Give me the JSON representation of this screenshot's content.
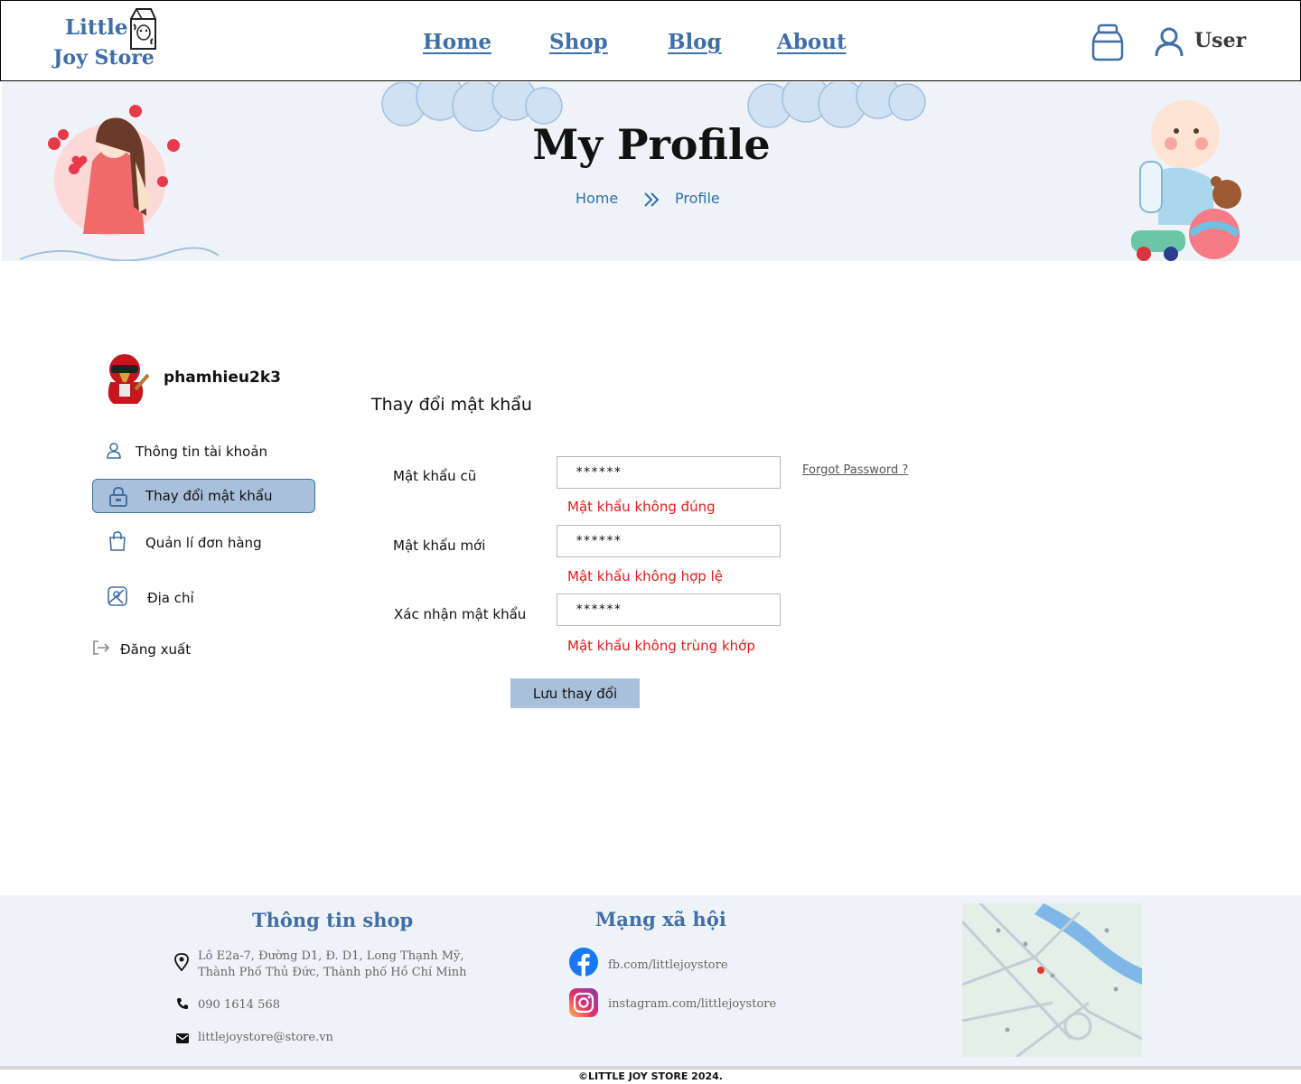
{
  "brand": {
    "line1": "Little",
    "line2": "Joy Store"
  },
  "nav": {
    "items": [
      "Home",
      "Shop",
      "Blog",
      "About"
    ]
  },
  "header": {
    "user_label": "User"
  },
  "banner": {
    "title": "My Profile",
    "breadcrumb_home": "Home",
    "breadcrumb_current": "Profile"
  },
  "sidebar": {
    "username": "phamhieu2k3",
    "items": [
      "Thông tin tài khoản",
      "Thay đổi mật khẩu",
      "Quản lí đơn hàng",
      "Địa chỉ",
      "Đăng xuất"
    ],
    "active_index": 1
  },
  "form": {
    "title": "Thay đổi mật khẩu",
    "fields": [
      {
        "label": "Mật khẩu cũ",
        "value": "******",
        "error": "Mật khẩu không đúng"
      },
      {
        "label": "Mật khẩu mới",
        "value": "******",
        "error": "Mật khẩu không hợp lệ"
      },
      {
        "label": "Xác nhận mật khẩu",
        "value": "******",
        "error": "Mật khẩu không trùng khớp"
      }
    ],
    "forgot_label": "Forgot Password ?",
    "save_label": "Lưu thay đổi"
  },
  "footer": {
    "shop_heading": "Thông tin shop",
    "address_line1": "Lô E2a-7, Đường D1, Đ. D1, Long Thạnh Mỹ,",
    "address_line2": "Thành Phố Thủ Đức, Thành phố Hồ Chí Minh",
    "phone": "090 1614 568",
    "email": "littlejoystore@store.vn",
    "social_heading": "Mạng xã hội",
    "facebook": "fb.com/littlejoystore",
    "instagram": "instagram.com/littlejoystore",
    "copyright": "©LITTLE JOY STORE 2024."
  },
  "colors": {
    "brand": "#3f6fa6",
    "link": "#2f6fa8",
    "active_bg": "#a9c0da",
    "error": "#e01b1b",
    "banner_bg": "#eff3f8",
    "footer_bg": "#eff3f8"
  }
}
